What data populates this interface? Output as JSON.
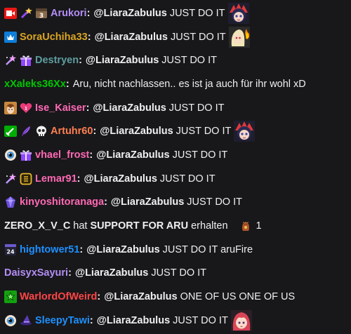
{
  "colors": {
    "background": "#18181b",
    "text": "#efeff1",
    "Arukori": "#b48ef5",
    "SoraUchiha33": "#daa520",
    "Destryen": "#5f9ea0",
    "xXaleks36Xx": "#00c800",
    "Ise_Kaiser": "#ff69b4",
    "Artuhr60": "#ff7f50",
    "vhael_frost": "#ff69b4",
    "Lemar91": "#ff69b4",
    "kinyoshitoranaga": "#ff69b4",
    "hightower51": "#1e90ff",
    "DaisyxSayuri": "#b48ef5",
    "WarlordOfWeird": "#ff4545",
    "SleepyTawi": "#1e90ff"
  },
  "messages": [
    {
      "badges": [
        "broadcaster-badge-icon",
        "wand-badge-icon",
        "sub-3-badge-icon"
      ],
      "user": "Arukori",
      "mention": "@LiaraZabulus",
      "text": "JUST DO IT",
      "emote": "aru-hype-emote"
    },
    {
      "badges": [
        "prime-badge-icon"
      ],
      "user": "SoraUchiha33",
      "mention": "@LiaraZabulus",
      "text": "JUST DO IT",
      "emote": "blonde-fire-emote"
    },
    {
      "badges": [
        "sparkle-wand-badge-icon",
        "gift-badge-icon"
      ],
      "user": "Destryen",
      "mention": "@LiaraZabulus",
      "text": "JUST DO IT"
    },
    {
      "badges": [],
      "user": "xXaleks36Xx",
      "mention": "",
      "text": "Aru, nicht nachlassen.. es ist ja auch für ihr wohl xD"
    },
    {
      "badges": [
        "anime-avatar-badge-icon",
        "heart-badge-icon"
      ],
      "user": "Ise_Kaiser",
      "mention": "@LiaraZabulus",
      "text": "JUST DO IT"
    },
    {
      "badges": [
        "moderator-sword-badge-icon",
        "feather-badge-icon",
        "skull-badge-icon"
      ],
      "user": "Artuhr60",
      "mention": "@LiaraZabulus",
      "text": "JUST DO IT",
      "emote": "aru-hype-emote"
    },
    {
      "badges": [
        "eye-orb-badge-icon",
        "gift-badge-icon"
      ],
      "user": "vhael_frost",
      "mention": "@LiaraZabulus",
      "text": "JUST DO IT"
    },
    {
      "badges": [
        "sparkle-wand-badge-icon",
        "rank-frame-badge-icon"
      ],
      "user": "Lemar91",
      "mention": "@LiaraZabulus",
      "text": "JUST DO IT"
    },
    {
      "badges": [
        "crystal-badge-icon"
      ],
      "user": "kinyoshitoranaga",
      "mention": "@LiaraZabulus",
      "text": "JUST DO IT"
    },
    {
      "type": "system",
      "user": "ZERO_X_V_C",
      "action": "hat",
      "reward": "SUPPORT FOR ARU",
      "suffix": "erhalten",
      "icon": "channel-points-bag-icon",
      "count": "1"
    },
    {
      "badges": [
        "calendar-24-badge-icon"
      ],
      "user": "hightower51",
      "mention": "@LiaraZabulus",
      "text": "JUST DO IT aruFire"
    },
    {
      "badges": [],
      "user": "DaisyxSayuri",
      "mention": "@LiaraZabulus",
      "text": "JUST DO IT"
    },
    {
      "badges": [
        "verified-star-badge-icon"
      ],
      "user": "WarlordOfWeird",
      "mention": "@LiaraZabulus",
      "text": "ONE OF US ONE OF US"
    },
    {
      "badges": [
        "eye-orb-badge-icon",
        "witch-hat-badge-icon"
      ],
      "user": "SleepyTawi",
      "mention": "@LiaraZabulus",
      "text": "JUST DO IT",
      "emote": "redhair-girl-emote"
    }
  ]
}
